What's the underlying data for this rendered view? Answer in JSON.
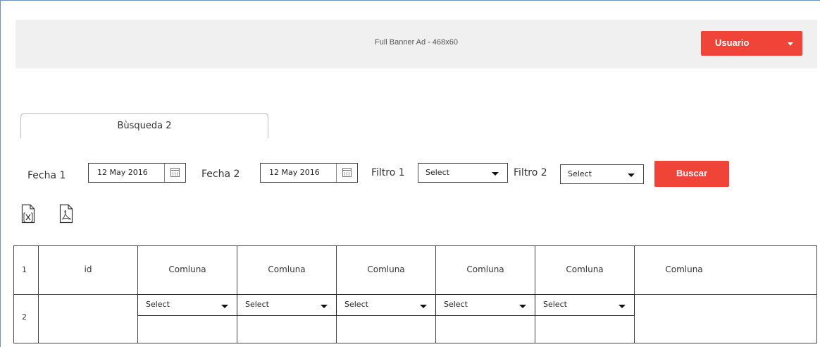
{
  "banner": {
    "ad_text": "Full Banner Ad - 468x60"
  },
  "user_menu": {
    "label": "Usuario"
  },
  "tabs": [
    {
      "label": "Bùsqueda 2"
    }
  ],
  "filters": {
    "fecha1_label": "Fecha 1",
    "fecha1_value": "12 May 2016",
    "fecha2_label": "Fecha 2",
    "fecha2_value": "12 May 2016",
    "filtro1_label": "Filtro 1",
    "filtro1_value": "Select",
    "filtro2_label": "Filtro 2",
    "filtro2_value": "Select",
    "search_label": "Buscar"
  },
  "export": {
    "icons": [
      "excel-export-icon",
      "pdf-export-icon"
    ]
  },
  "table": {
    "row_numbers": [
      "1",
      "2"
    ],
    "headers": [
      "id",
      "Comluna",
      "Comluna",
      "Comluna",
      "Comluna",
      "Comluna",
      "Comluna"
    ],
    "filter_selects": [
      "Select",
      "Select",
      "Select",
      "Select",
      "Select"
    ]
  },
  "colors": {
    "accent": "#f04438",
    "banner_bg": "#f0f0f0"
  }
}
